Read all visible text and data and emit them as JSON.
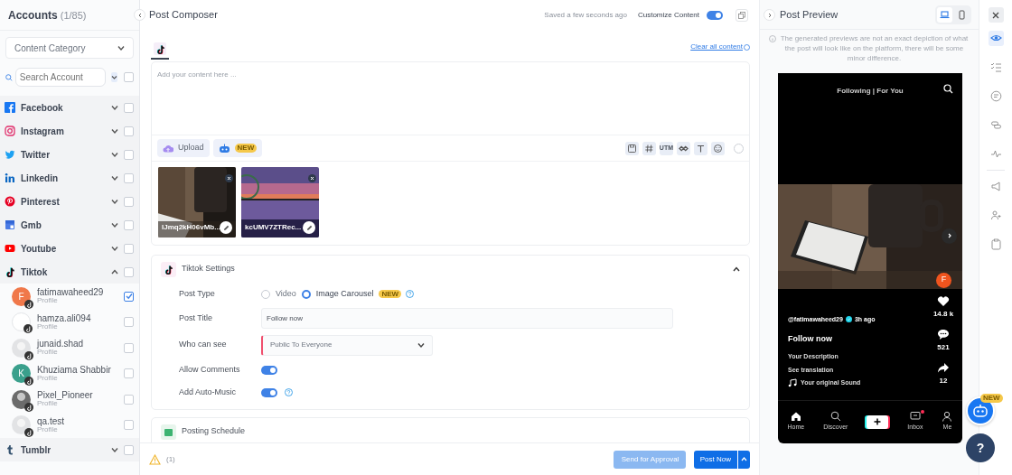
{
  "sidebar": {
    "title": "Accounts",
    "count": "(1/85)",
    "category_select": "Content Category",
    "search": {
      "placeholder": "Search Account"
    },
    "select_all": {
      "checked": false
    },
    "platforms": [
      {
        "kind": "facebook",
        "name": "Facebook",
        "expanded": false,
        "checked": false
      },
      {
        "kind": "instagram",
        "name": "Instagram",
        "expanded": false,
        "checked": false
      },
      {
        "kind": "twitter",
        "name": "Twitter",
        "expanded": false,
        "checked": false
      },
      {
        "kind": "linkedin",
        "name": "Linkedin",
        "expanded": false,
        "checked": false
      },
      {
        "kind": "pinterest",
        "name": "Pinterest",
        "expanded": false,
        "checked": false
      },
      {
        "kind": "gmb",
        "name": "Gmb",
        "expanded": false,
        "checked": false
      },
      {
        "kind": "youtube",
        "name": "Youtube",
        "expanded": false,
        "checked": false
      },
      {
        "kind": "tiktok",
        "name": "Tiktok",
        "expanded": true,
        "checked": false,
        "accounts": [
          {
            "name": "fatimawaheed29",
            "subtitle": "Profile",
            "checked": true,
            "avatar": {
              "kind": "initial",
              "initial": "F",
              "color": "#f0784a"
            }
          },
          {
            "name": "hamza.ali094",
            "subtitle": "Profile",
            "checked": false,
            "avatar": {
              "kind": "blank"
            }
          },
          {
            "name": "junaid.shad",
            "subtitle": "Profile",
            "checked": false,
            "avatar": {
              "kind": "placeholder"
            }
          },
          {
            "name": "Khuziama Shabbir",
            "subtitle": "Profile",
            "checked": false,
            "avatar": {
              "kind": "initial",
              "initial": "K",
              "color": "#3aa08c"
            }
          },
          {
            "name": "Pixel_Pioneer",
            "subtitle": "Profile",
            "checked": false
          },
          {
            "name": "qa.test",
            "subtitle": "Profile",
            "checked": false,
            "avatar": {
              "kind": "placeholder"
            }
          }
        ]
      },
      {
        "kind": "tumblr",
        "name": "Tumblr",
        "expanded": false,
        "checked": false
      }
    ]
  },
  "composer": {
    "title": "Post Composer",
    "saved_status": "Saved a few seconds ago",
    "customize_content": {
      "label": "Customize Content",
      "on": true
    },
    "tabs": [
      {
        "kind": "tiktok",
        "selected": true
      }
    ],
    "clear_link": "Clear all content",
    "editor": {
      "placeholder": "Add your content here ..."
    },
    "upload_button": "Upload",
    "ai_badge": "NEW",
    "toolbar": [
      {
        "kind": "save"
      },
      {
        "kind": "hashtag"
      },
      {
        "kind": "utm",
        "label": "UTM"
      },
      {
        "kind": "link"
      },
      {
        "kind": "text"
      },
      {
        "kind": "emoji"
      },
      {
        "kind": "more"
      }
    ],
    "media": [
      {
        "filename": "lJmq2kH06vMb..."
      },
      {
        "filename": "kcUMV7ZTRec..."
      }
    ],
    "settings": {
      "title": "Tiktok Settings",
      "expanded": true,
      "post_type": {
        "label": "Post Type",
        "options": [
          {
            "label": "Video",
            "selected": false
          },
          {
            "label": "Image Carousel",
            "selected": true,
            "badge": "NEW"
          }
        ]
      },
      "post_title": {
        "label": "Post Title",
        "value": "Follow now"
      },
      "who_can_see": {
        "label": "Who can see",
        "value": "Public To Everyone"
      },
      "allow_comments": {
        "label": "Allow Comments",
        "on": true
      },
      "auto_music": {
        "label": "Add Auto-Music",
        "on": true
      }
    },
    "schedule": {
      "title": "Posting Schedule"
    },
    "footer": {
      "warning_count": "(1)",
      "approval_button": {
        "label": "Send for Approval",
        "disabled": true
      },
      "post_button": "Post Now"
    }
  },
  "preview": {
    "title": "Post Preview",
    "devices": [
      {
        "kind": "desktop",
        "selected": true
      },
      {
        "kind": "mobile",
        "selected": false
      }
    ],
    "notice": "The generated previews are not an exact depiction of what the post will look like on the platform, there will be some minor difference.",
    "tiktok": {
      "header": "Following | **For You**",
      "avatar": "F",
      "likes": "14.8 k",
      "comments": "521",
      "shares": "12",
      "handle": "@fatimawaheed29",
      "time": "3h ago",
      "caption": "Follow now",
      "description": "Your Description",
      "translation": "See translation",
      "sound": "Your original Sound",
      "nav": [
        {
          "kind": "home",
          "label": "Home"
        },
        {
          "kind": "discover",
          "label": "Discover"
        },
        {
          "kind": "create"
        },
        {
          "kind": "inbox",
          "label": "Inbox",
          "dot": true
        },
        {
          "kind": "me",
          "label": "Me"
        }
      ]
    }
  },
  "rail": [
    {
      "kind": "preview",
      "selected": true
    },
    {
      "kind": "checklist",
      "selected": false
    },
    {
      "kind": "notes",
      "selected": false
    },
    {
      "kind": "links",
      "selected": false
    },
    {
      "kind": "activity",
      "selected": false
    },
    {
      "kind": "megaphone",
      "selected": false
    },
    {
      "kind": "people",
      "selected": false
    },
    {
      "kind": "clipboard",
      "selected": false
    }
  ],
  "assistant_badge": "NEW",
  "help_button": "?"
}
